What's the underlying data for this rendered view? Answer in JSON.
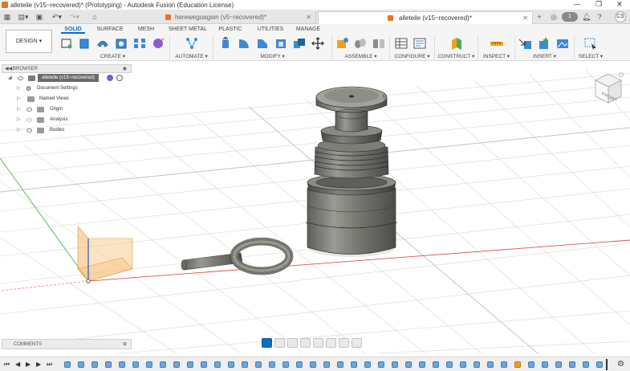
{
  "window": {
    "title": "alleteile (v15~recovered)* (Prototyping) - Autodesk Fusion (Education License)",
    "controls": [
      "—",
      "❐",
      "✕"
    ]
  },
  "quick_access": {
    "grid_icon": "apps-grid-icon",
    "file_icon": "file-icon",
    "save_icon": "save-icon",
    "undo_icon": "undo-icon",
    "redo_icon": "redo-icon",
    "home_icon": "home-icon"
  },
  "tabs": [
    {
      "label": "herewegoagain (v5~recovered)*",
      "active": false
    },
    {
      "label": "alleteile (v15~recovered)*",
      "active": true
    }
  ],
  "tab_bar_right": {
    "new_tab": "+",
    "badge_count": "1",
    "avatar_initials": "CS"
  },
  "workspace": {
    "label": "DESIGN ▾"
  },
  "ribbon_tabs": [
    "SOLID",
    "SURFACE",
    "MESH",
    "SHEET METAL",
    "PLASTIC",
    "UTILITIES",
    "MANAGE"
  ],
  "ribbon_groups": [
    "CREATE ▾",
    "AUTOMATE ▾",
    "MODIFY ▾",
    "ASSEMBLE ▾",
    "CONFIGURE ▾",
    "CONSTRUCT ▾",
    "INSPECT ▾",
    "INSERT ▾",
    "SELECT ▾"
  ],
  "browser": {
    "title": "BROWSER",
    "root": "alleteile (v15~recovered)",
    "items": [
      "Document Settings",
      "Named Views",
      "Origin",
      "Analysis",
      "Bodies"
    ]
  },
  "viewcube": {
    "face": "FRONT"
  },
  "comments": {
    "title": "COMMENTS"
  },
  "playback": [
    "⏮",
    "◀",
    "▶",
    "▶",
    "⏭"
  ],
  "colors": {
    "accent": "#0b6ec4",
    "body": "#7c7c76",
    "grid": "#d8d8d8",
    "x_axis": "#e05050",
    "y_axis": "#4bb44b",
    "plane": "#f5b86a",
    "fusion_orange": "#e8732a"
  }
}
